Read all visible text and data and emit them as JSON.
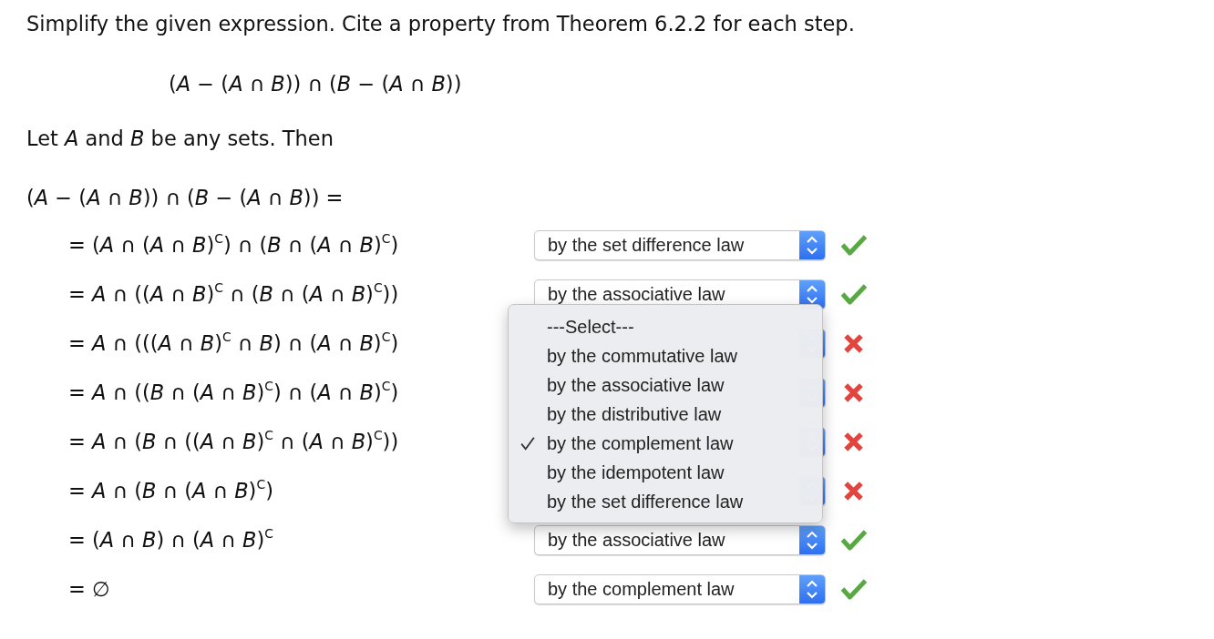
{
  "instruction": "Simplify the given expression. Cite a property from Theorem 6.2.2 for each step.",
  "expression": "(*A* − (*A* ∩ *B*)) ∩ (*B* − (*A* ∩ *B*))",
  "intro": "Let *A* and *B* be any sets. Then",
  "start": "(*A* − (*A* ∩ *B*)) ∩ (*B* − (*A* ∩ *B*)) =",
  "steps": [
    {
      "expression": "= (*A* ∩ (*A* ∩ *B*)$^{C}$) ∩ (*B* ∩ (*A* ∩ *B*)$^{C}$)",
      "choice": "by the set difference law",
      "correct": true
    },
    {
      "expression": "= *A* ∩ ((*A* ∩ *B*)$^{C}$ ∩ (*B* ∩ (*A* ∩ *B*)$^{C}$))",
      "choice": "by the associative law",
      "correct": true
    },
    {
      "expression": "= *A* ∩ (((*A* ∩ *B*)$^{C}$ ∩ *B*) ∩ (*A* ∩ *B*)$^{C}$)",
      "correct": false
    },
    {
      "expression": "= *A* ∩ ((*B* ∩ (*A* ∩ *B*)$^{C}$) ∩ (*A* ∩ *B*)$^{C}$)",
      "correct": false
    },
    {
      "expression": "= *A* ∩ (*B* ∩ ((*A* ∩ *B*)$^{C}$ ∩ (*A* ∩ *B*)$^{C}$))",
      "correct": false
    },
    {
      "expression": "= *A* ∩ (*B* ∩ (*A* ∩ *B*)$^{C}$)",
      "correct": false
    },
    {
      "expression": "= (*A* ∩ *B*) ∩ (*A* ∩ *B*)$^{C}$",
      "choice": "by the associative law",
      "correct": true
    },
    {
      "expression": "= ∅",
      "choice": "by the complement law",
      "correct": true
    }
  ],
  "open_menu": {
    "options": [
      {
        "label": "---Select---",
        "selected": false
      },
      {
        "label": "by the commutative law",
        "selected": false
      },
      {
        "label": "by the associative law",
        "selected": false
      },
      {
        "label": "by the distributive law",
        "selected": false
      },
      {
        "label": "by the complement law",
        "selected": true
      },
      {
        "label": "by the idempotent law",
        "selected": false
      },
      {
        "label": "by the set difference law",
        "selected": false
      }
    ]
  }
}
